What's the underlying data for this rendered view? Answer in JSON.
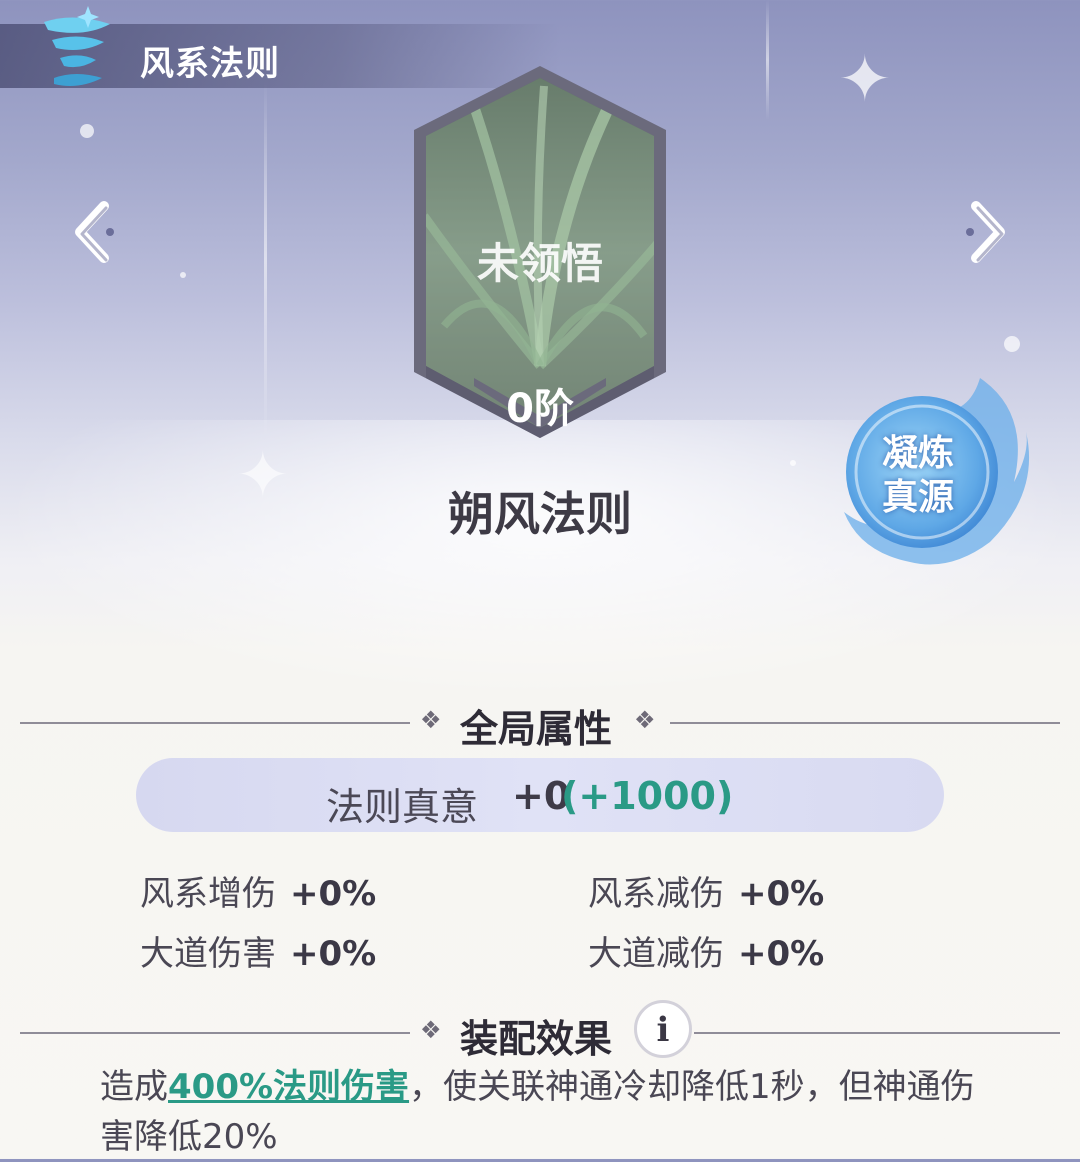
{
  "header": {
    "title": "风系法则",
    "icon": "wind-tornado-icon"
  },
  "navigation": {
    "prev_icon": "chevron-left-icon",
    "next_icon": "chevron-right-icon"
  },
  "law_card": {
    "status": "未领悟",
    "rank": "0阶",
    "name": "朔风法则",
    "image": "grass-blades"
  },
  "condense_button": {
    "line1": "凝炼",
    "line2": "真源"
  },
  "global_attributes": {
    "title": "全局属性",
    "truth": {
      "label": "法则真意",
      "value": "+0",
      "bonus": "(+1000)"
    },
    "stats": [
      {
        "label": "风系增伤",
        "value": "+0%"
      },
      {
        "label": "风系减伤",
        "value": "+0%"
      },
      {
        "label": "大道伤害",
        "value": "+0%"
      },
      {
        "label": "大道减伤",
        "value": "+0%"
      }
    ]
  },
  "equip_effect": {
    "title": "装配效果",
    "info_icon": "i",
    "prefix": "造成",
    "highlight": "400%法则伤害",
    "suffix": "，使关联神通冷却降低1秒，但神通伤害降低20%"
  },
  "colors": {
    "accent_teal": "#2a9a86",
    "text_dark": "#2e2b36",
    "bar_lavender": "#d6d8f0"
  }
}
